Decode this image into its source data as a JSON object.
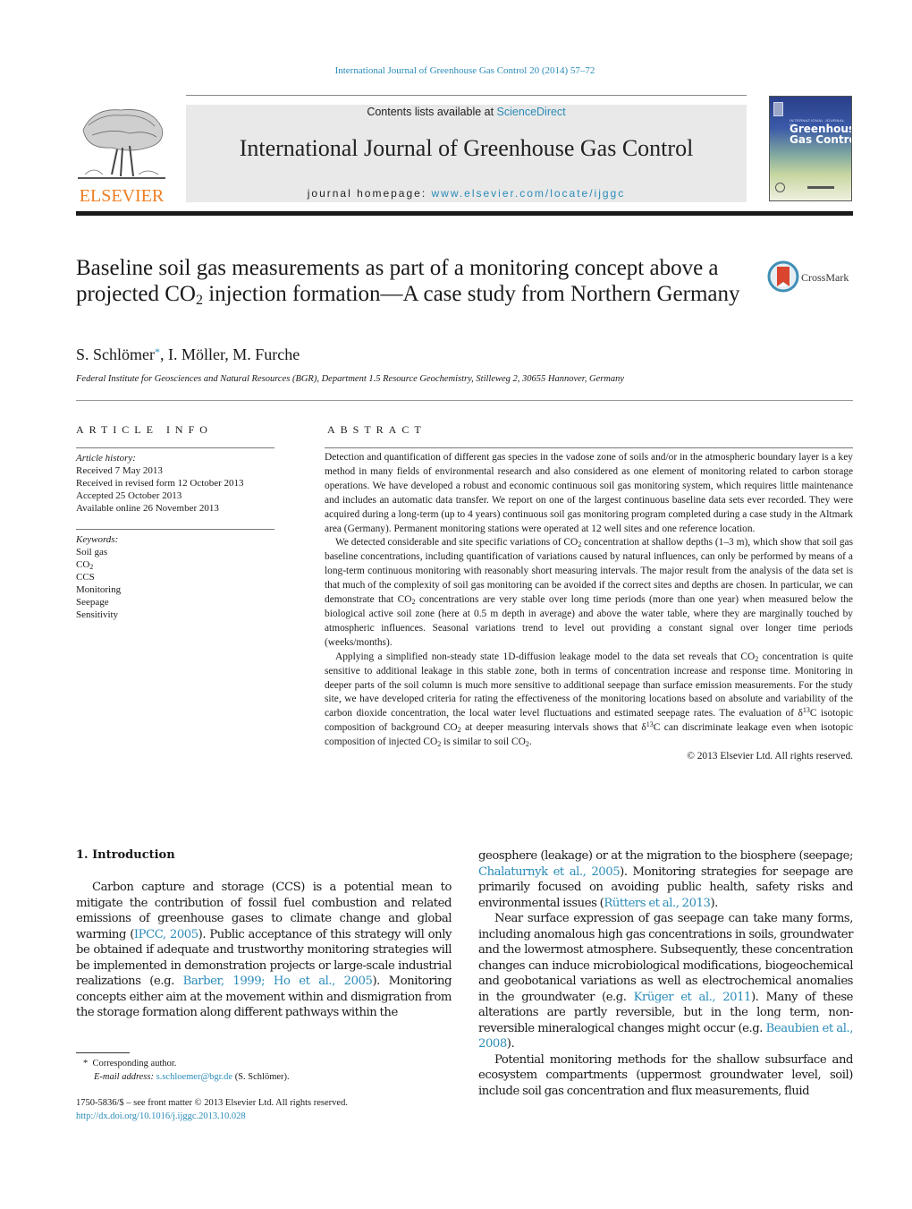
{
  "journal_ref": "International Journal of Greenhouse Gas Control 20 (2014) 57–72",
  "header": {
    "publisher_wordmark": "ELSEVIER",
    "contents_prefix": "Contents lists available at ",
    "contents_link": "ScienceDirect",
    "journal_title": "International Journal of Greenhouse Gas Control",
    "homepage_prefix": "journal homepage: ",
    "homepage_link": "www.elsevier.com/locate/ijggc",
    "cover_small_text": "INTERNATIONAL JOURNAL OF",
    "cover_title_line1": "Greenhouse",
    "cover_title_line2": "Gas Control"
  },
  "article": {
    "title_part1": "Baseline soil gas measurements as part of a monitoring concept above a projected CO",
    "title_sub": "2",
    "title_part2": " injection formation—A case study from Northern Germany",
    "crossmark_label": "CrossMark",
    "authors": [
      {
        "name": "S. Schlömer",
        "corresponding_mark": "*"
      },
      {
        "name": "I. Möller"
      },
      {
        "name": "M. Furche"
      }
    ],
    "affiliation": "Federal Institute for Geosciences and Natural Resources (BGR), Department 1.5 Resource Geochemistry, Stilleweg 2, 30655 Hannover, Germany"
  },
  "article_info": {
    "label": "ARTICLE INFO",
    "history_heading": "Article history:",
    "history": [
      "Received 7 May 2013",
      "Received in revised form 12 October 2013",
      "Accepted 25 October 2013",
      "Available online 26 November 2013"
    ],
    "keywords_heading": "Keywords:",
    "keywords": [
      "Soil gas",
      "CO2",
      "CCS",
      "Monitoring",
      "Seepage",
      "Sensitivity"
    ]
  },
  "abstract": {
    "label": "ABSTRACT",
    "p1": "Detection and quantification of different gas species in the vadose zone of soils and/or in the atmospheric boundary layer is a key method in many fields of environmental research and also considered as one element of monitoring related to carbon storage operations. We have developed a robust and economic continuous soil gas monitoring system, which requires little maintenance and includes an automatic data transfer. We report on one of the largest continuous baseline data sets ever recorded. They were acquired during a long-term (up to 4 years) continuous soil gas monitoring program completed during a case study in the Altmark area (Germany). Permanent monitoring stations were operated at 12 well sites and one reference location.",
    "p2_a": "We detected considerable and site specific variations of CO",
    "p2_b": " concentration at shallow depths (1–3 m), which show that soil gas baseline concentrations, including quantification of variations caused by natural influences, can only be performed by means of a long-term continuous monitoring with reasonably short measuring intervals. The major result from the analysis of the data set is that much of the complexity of soil gas monitoring can be avoided if the correct sites and depths are chosen. In particular, we can demonstrate that CO",
    "p2_c": " concentrations are very stable over long time periods (more than one year) when measured below the biological active soil zone (here at 0.5 m depth in average) and above the water table, where they are marginally touched by atmospheric influences. Seasonal variations trend to level out providing a constant signal over longer time periods (weeks/months).",
    "p3_a": "Applying a simplified non-steady state 1D-diffusion leakage model to the data set reveals that CO",
    "p3_b": " concentration is quite sensitive to additional leakage in this stable zone, both in terms of concentration increase and response time. Monitoring in deeper parts of the soil column is much more sensitive to additional seepage than surface emission measurements. For the study site, we have developed criteria for rating the effectiveness of the monitoring locations based on absolute and variability of the carbon dioxide concentration, the local water level fluctuations and estimated seepage rates. The evaluation of δ",
    "p3_c": "C isotopic composition of background CO",
    "p3_d": " at deeper measuring intervals shows that δ",
    "p3_e": "C can discriminate leakage even when isotopic composition of injected CO",
    "p3_f": " is similar to soil CO",
    "p3_g": ".",
    "sub2": "2",
    "sup13": "13",
    "copyright": "© 2013 Elsevier Ltd. All rights reserved."
  },
  "intro": {
    "heading": "1.  Introduction",
    "left_p1_a": "Carbon capture and storage (CCS) is a potential mean to mitigate the contribution of fossil fuel combustion and related emissions of greenhouse gases to climate change and global warming (",
    "left_cite1": "IPCC, 2005",
    "left_p1_b": "). Public acceptance of this strategy will only be obtained if adequate and trustworthy monitoring strategies will be implemented in demonstration projects or large-scale industrial realizations (e.g. ",
    "left_cite2": "Barber, 1999; Ho et al., 2005",
    "left_p1_c": "). Monitoring concepts either aim at the movement within and dismigration from the storage formation along different pathways within the",
    "right_p1_a": "geosphere (leakage) or at the migration to the biosphere (seepage; ",
    "right_cite1": "Chalaturnyk et al., 2005",
    "right_p1_b": "). Monitoring strategies for seepage are primarily focused on avoiding public health, safety risks and environmental issues (",
    "right_cite2": "Rütters et al., 2013",
    "right_p1_c": ").",
    "right_p2_a": "Near surface expression of gas seepage can take many forms, including anomalous high gas concentrations in soils, groundwater and the lowermost atmosphere. Subsequently, these concentration changes can induce microbiological modifications, biogeochemical and geobotanical variations as well as electrochemical anomalies in the groundwater (e.g. ",
    "right_cite3": "Krüger et al., 2011",
    "right_p2_b": "). Many of these alterations are partly reversible, but in the long term, non-reversible mineralogical changes might occur (e.g. ",
    "right_cite4": "Beaubien et al., 2008",
    "right_p2_c": ").",
    "right_p3": "Potential monitoring methods for the shallow subsurface and ecosystem compartments (uppermost groundwater level, soil) include soil gas concentration and flux measurements, fluid"
  },
  "footnote": {
    "mark": "*",
    "corresponding": "Corresponding author.",
    "email_label": "E-mail address:",
    "email": "s.schloemer@bgr.de",
    "email_owner": "(S. Schlömer)."
  },
  "front_matter": {
    "issn_line": "1750-5836/$ – see front matter © 2013 Elsevier Ltd. All rights reserved.",
    "doi": "http://dx.doi.org/10.1016/j.ijggc.2013.10.028"
  },
  "colors": {
    "link": "#2a8bb8",
    "elsevier_orange": "#ee7e22",
    "header_panel": "#e9e9e9"
  }
}
